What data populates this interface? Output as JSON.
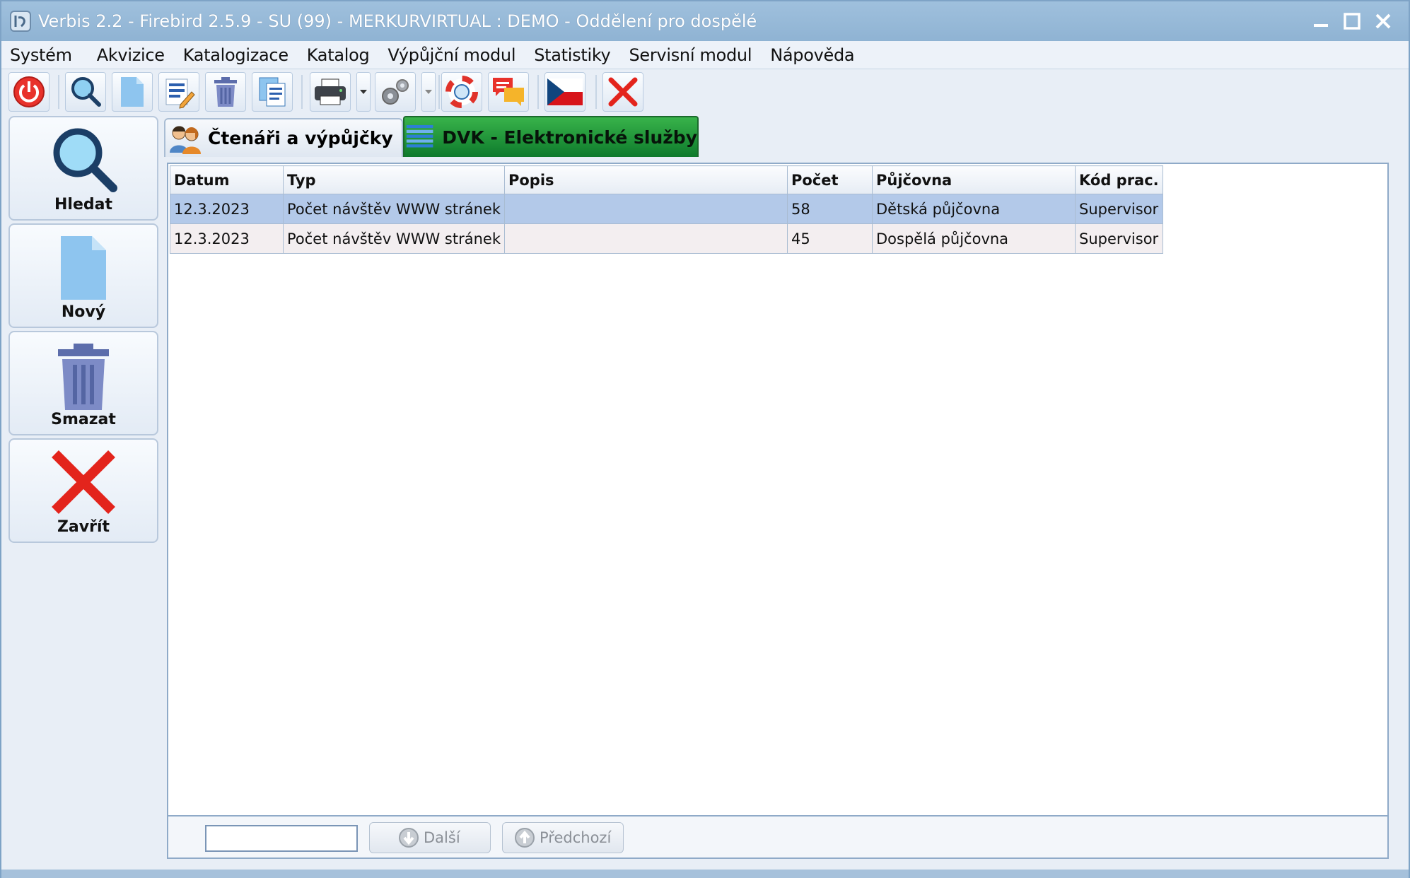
{
  "window": {
    "title": "Verbis 2.2 - Firebird 2.5.9 - SU (99) - MERKURVIRTUAL : DEMO - Oddělení pro dospělé"
  },
  "menu": {
    "items": [
      "Systém",
      "Akvizice",
      "Katalogizace",
      "Katalog",
      "Výpůjční modul",
      "Statistiky",
      "Servisní modul",
      "Nápověda"
    ]
  },
  "toolbar": {
    "icons": [
      "power-icon",
      "search-icon",
      "new-document-icon",
      "edit-document-icon",
      "trash-icon",
      "copy-document-icon",
      "printer-icon",
      "gears-icon",
      "lifebuoy-icon",
      "chat-icon",
      "czech-flag-icon",
      "close-icon"
    ]
  },
  "sidebar": {
    "search_label": "Hledat",
    "new_label": "Nový",
    "delete_label": "Smazat",
    "close_label": "Zavřít"
  },
  "tabs": [
    {
      "label": "Čtenáři a výpůjčky",
      "active": false
    },
    {
      "label": "DVK - Elektronické služby",
      "active": true
    }
  ],
  "grid": {
    "columns": [
      "Datum",
      "Typ",
      "Popis",
      "Počet",
      "Půjčovna",
      "Kód prac."
    ],
    "rows": [
      {
        "datum": "12.3.2023",
        "typ": "Počet návštěv WWW stránek",
        "popis": "",
        "pocet": "58",
        "pujcovna": "Dětská půjčovna",
        "kod": "Supervisor",
        "selected": true
      },
      {
        "datum": "12.3.2023",
        "typ": "Počet návštěv WWW stránek",
        "popis": "",
        "pocet": "45",
        "pujcovna": "Dospělá půjčovna",
        "kod": "Supervisor",
        "selected": false
      }
    ]
  },
  "search": {
    "value": "",
    "next_label": "Další",
    "prev_label": "Předchozí"
  },
  "colors": {
    "selection": "#b3c9e9",
    "active_tab": "#1f9a3c",
    "title_bar": "#8fb3d3"
  }
}
